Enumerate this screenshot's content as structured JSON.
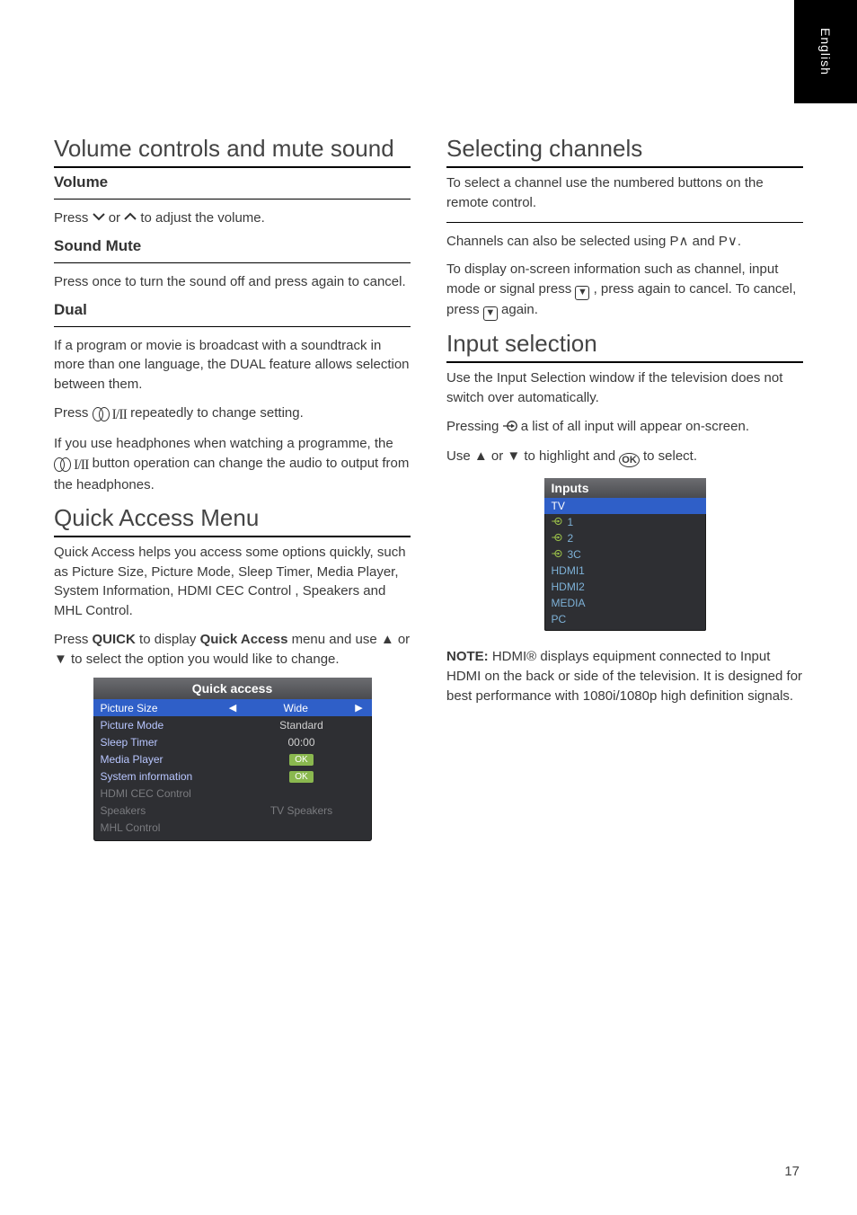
{
  "black_tab": "English",
  "page_number": "17",
  "left": {
    "sec1": {
      "head": "Volume controls and mute sound",
      "sub": "Volume",
      "p1a": "Press ",
      "p1b": " or ",
      "p1c": " to adjust the volume."
    },
    "sec2": {
      "sub": "Sound Mute",
      "p1": "Press  once to turn the sound off and press again to cancel."
    },
    "sec3": {
      "sub": "Dual",
      "p1a": "If a program or movie is broadcast with a soundtrack in more than one language, the DUAL feature allows selection between them.",
      "p2a": "Press ",
      "p2b": " repeatedly to change setting.",
      "p3a": "If you use headphones when watching a programme, the ",
      "p3b": " button operation can change the audio to output from the headphones."
    },
    "sec4": {
      "head": "Quick Access Menu",
      "p1": "Quick Access helps you access some options quickly, such as Picture Size, Picture Mode, Sleep Timer, Media Player, System Information, HDMI CEC Control , Speakers and MHL Control.",
      "p2a": "Press ",
      "p2b": " to display ",
      "p2c": " menu and use ▲ or ▼ to select the option you would like to change.",
      "quick_label": "Quick Access"
    },
    "qa_title": "Quick access",
    "qa_rows": [
      {
        "label": "Picture Size",
        "value": "Wide",
        "selected": true,
        "type": "arrows"
      },
      {
        "label": "Picture Mode",
        "value": "Standard",
        "type": "text"
      },
      {
        "label": "Sleep Timer",
        "value": "00:00",
        "type": "text"
      },
      {
        "label": "Media Player",
        "value": "OK",
        "type": "ok"
      },
      {
        "label": "System information",
        "value": "OK",
        "type": "ok"
      },
      {
        "label": "HDMI CEC Control",
        "value": "",
        "disabled": true,
        "type": "text"
      },
      {
        "label": "Speakers",
        "value": "TV Speakers",
        "disabled": true,
        "type": "text"
      },
      {
        "label": "MHL Control",
        "value": "",
        "disabled": true,
        "type": "text"
      }
    ]
  },
  "right": {
    "sec1": {
      "head": "Selecting channels",
      "p1": "To select a channel use the numbered buttons on the remote control."
    },
    "sec2": {
      "p1": "Channels can also be selected using P∧ and P∨.",
      "p2a": "To display on-screen information such as channel, input mode or signal press ",
      "p2b": ", press again to cancel. To cancel, press ",
      "p2c": " again."
    },
    "sec3": {
      "head": "Input selection",
      "p1": "Use the Input Selection window if the television does not switch over automatically.",
      "p2a": "Pressing ",
      "p2b": " a list of all input will appear on-screen.",
      "p3a": "Use ▲ or ▼ to highlight and ",
      "p3b": " to select.",
      "inputs_title": "Inputs",
      "inputs_rows": [
        {
          "label": "TV",
          "selected": true
        },
        {
          "label": "1",
          "icon": true
        },
        {
          "label": "2",
          "icon": true
        },
        {
          "label": "3C",
          "icon": true
        },
        {
          "label": "HDMI1"
        },
        {
          "label": "HDMI2"
        },
        {
          "label": "MEDIA"
        },
        {
          "label": "PC"
        }
      ],
      "note_label": "NOTE: ",
      "note": "HDMI® displays equipment connected to Input HDMI on the back or side of the television. It is designed for best performance with 1080i/1080p high definition signals."
    }
  }
}
